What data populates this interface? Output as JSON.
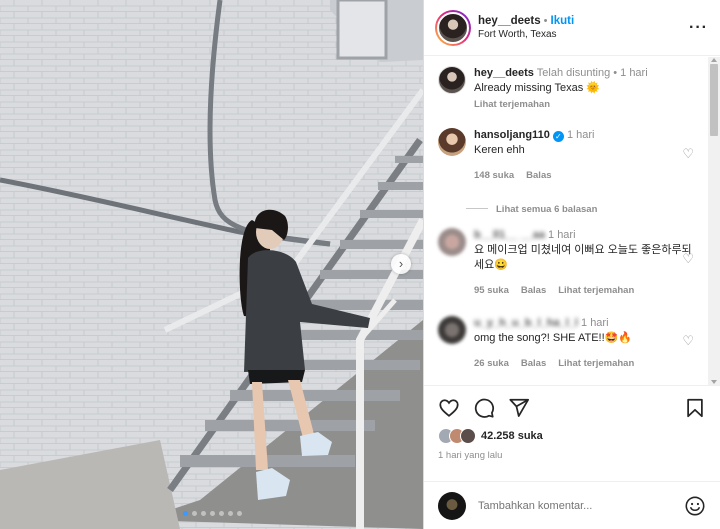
{
  "header": {
    "username": "hey__deets",
    "separator": "•",
    "follow_label": "Ikuti",
    "location": "Fort Worth, Texas",
    "more_label": "···"
  },
  "caption": {
    "username": "hey__deets",
    "meta": "Telah disunting  •  1 hari",
    "text": "Already missing Texas 🌞",
    "translate_label": "Lihat terjemahan"
  },
  "comments": [
    {
      "username": "hansoljang110",
      "verified": true,
      "time": "1 hari",
      "text": "Keren ehh",
      "likes": "148 suka",
      "reply_label": "Balas",
      "view_replies": "Lihat semua 6 balasan"
    },
    {
      "username": "b__ll1__ __aa",
      "time": "1 hari",
      "text": "요 메이크업 미쳤네여 이뻐요 오늘도 좋은하루되세요😀",
      "likes": "95 suka",
      "reply_label": "Balas",
      "translate_label": "Lihat terjemahan"
    },
    {
      "username": "u_y_h_u_b_l_ha_l_l",
      "time": "1 hari",
      "text": "omg the song?! SHE ATE!!🤩🔥",
      "likes": "26 suka",
      "reply_label": "Balas",
      "translate_label": "Lihat terjemahan"
    }
  ],
  "stats": {
    "likes": "42.258 suka",
    "posted": "1 hari yang lalu"
  },
  "add_comment": {
    "placeholder": "Tambahkan komentar..."
  },
  "carousel": {
    "next_label": "›",
    "slide_count": 7,
    "active_index": 0
  },
  "icons": {
    "like": "heart-icon",
    "comment": "comment-bubble-icon",
    "share": "paper-plane-icon",
    "save": "bookmark-icon",
    "emoji": "smiley-icon"
  },
  "colors": {
    "accent": "#0095f6",
    "muted": "#8e8e8e",
    "text": "#262626"
  }
}
